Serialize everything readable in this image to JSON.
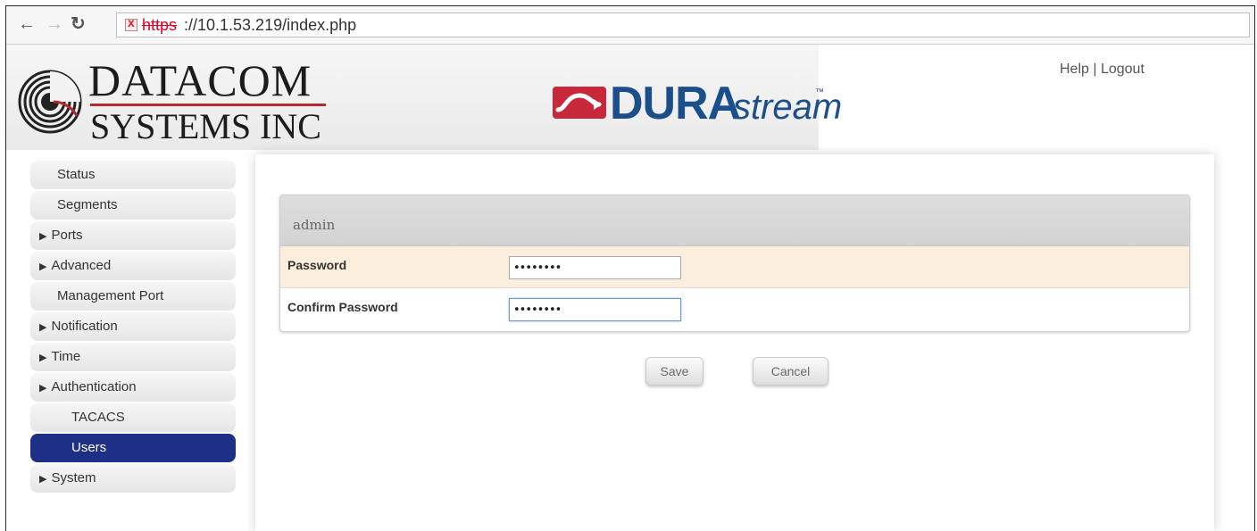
{
  "browser": {
    "url_scheme": "https",
    "url_rest": "://10.1.53.219/index.php"
  },
  "header": {
    "company_line1": "DATACOM",
    "company_line2": "SYSTEMS INC",
    "product_name": "DURA",
    "product_suffix": "stream",
    "product_tm": "™",
    "help_link": "Help",
    "link_separator": " | ",
    "logout_link": "Logout"
  },
  "sidebar": {
    "items": [
      {
        "label": "Status"
      },
      {
        "label": "Segments"
      },
      {
        "label": "Ports"
      },
      {
        "label": "Advanced"
      },
      {
        "label": "Management Port"
      },
      {
        "label": "Notification"
      },
      {
        "label": "Time"
      },
      {
        "label": "Authentication"
      },
      {
        "label": "TACACS"
      },
      {
        "label": "Users"
      },
      {
        "label": "System"
      }
    ],
    "expand_glyph": "▶"
  },
  "panel": {
    "title": "admin",
    "password_label": "Password",
    "password_value": "••••••••",
    "confirm_label": "Confirm Password",
    "confirm_value": "••••••••"
  },
  "actions": {
    "save_label": "Save",
    "cancel_label": "Cancel"
  },
  "colors": {
    "active_item": "#1e2f86",
    "brand_red": "#b52830",
    "product_blue": "#1a4f8b",
    "row_highlight": "#fceedd"
  },
  "icons": {
    "back": "arrow-left-icon",
    "forward": "arrow-right-icon",
    "reload": "reload-icon",
    "security": "insecure-lock-icon"
  }
}
